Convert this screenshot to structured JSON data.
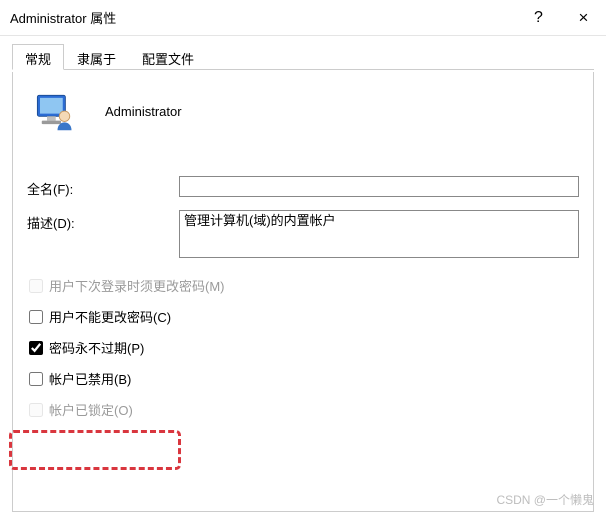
{
  "titlebar": {
    "title": "Administrator 属性",
    "help": "?",
    "close": "×"
  },
  "tabs": {
    "general": "常规",
    "member_of": "隶属于",
    "profile": "配置文件"
  },
  "user": {
    "name": "Administrator"
  },
  "form": {
    "fullname_label": "全名(F):",
    "fullname_value": "",
    "description_label": "描述(D):",
    "description_value": "管理计算机(域)的内置帐户"
  },
  "checks": {
    "must_change_label": "用户下次登录时须更改密码(M)",
    "cannot_change_label": "用户不能更改密码(C)",
    "never_expires_label": "密码永不过期(P)",
    "disabled_label": "帐户已禁用(B)",
    "locked_label": "帐户已锁定(O)"
  },
  "watermark": "CSDN @一个懒鬼"
}
